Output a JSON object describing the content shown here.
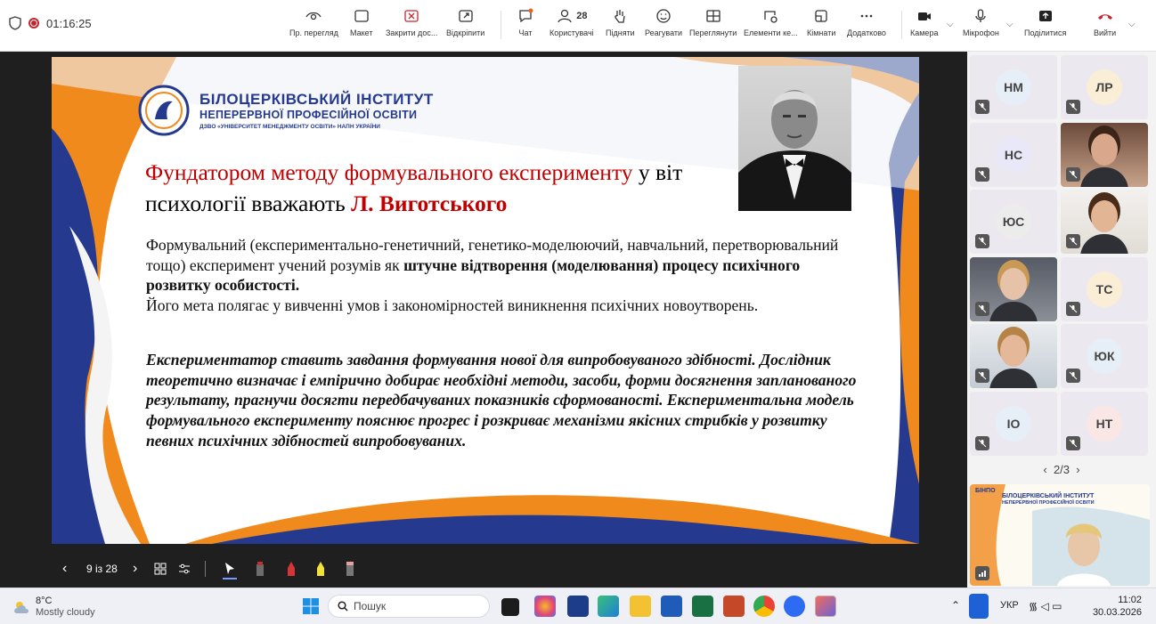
{
  "meeting": {
    "timer": "01:16:25"
  },
  "toolbar": {
    "view": "Пр. перегляд",
    "layout": "Макет",
    "close_content": "Закрити дос...",
    "undock": "Відкріпити",
    "chat": "Чат",
    "people": "Користувачі",
    "people_count": "28",
    "raise": "Підняти",
    "react": "Реагувати",
    "view_mode": "Переглянути",
    "apps": "Елементи ке...",
    "rooms": "Кімнати",
    "more": "Додатково",
    "camera": "Камера",
    "mic": "Мікрофон",
    "share": "Поділитися",
    "leave": "Вийти"
  },
  "slide": {
    "institute_line1": "БІЛОЦЕРКІВСЬКИЙ ІНСТИТУТ",
    "institute_line2": "НЕПЕРЕРВНОЇ ПРОФЕСІЙНОЇ ОСВІТИ",
    "institute_line3": "ДЗВО «УНІВЕРСИТЕТ МЕНЕДЖМЕНТУ ОСВІТИ» НАПН УКРАЇНИ",
    "title_red": "Фундатором методу формувального експерименту",
    "title_black": " у віт",
    "title_line2": "психології вважають ",
    "title_name": "Л. Виготського",
    "p1_a": "Формувальний (експериментально-генетичний, генетико-моделюючий, навчальний, перетворювальний тощо) експеримент учений розумів як ",
    "p1_bold": "штучне відтворення (моделювання) процесу психічного розвитку особистості.",
    "p1_b": "Його мета полягає у вивченні умов і закономірностей виникнення психічних новоутворень.",
    "p2": "Експериментатор ставить завдання формування нової для випробовуваного здібності. Дослідник теоретично визначає і емпірично добирає необхідні методи, засоби, форми досягнення запланованого результату, прагнучи досягти передбачуваних показників сформованості. Експериментальна модель формувального експерименту пояснює прогрес і розкриває механізми якісних стрибків у розвитку певних психічних здібностей випробовуваних."
  },
  "pager": {
    "label": "9 із 28"
  },
  "participants": [
    {
      "initials": "НМ",
      "color": "#e6eff8"
    },
    {
      "initials": "ЛР",
      "color": "#fbeed7"
    },
    {
      "initials": "НС",
      "color": "#e8e8f8"
    },
    {
      "initials": "",
      "color": ""
    },
    {
      "initials": "ЮС",
      "color": "#ececec"
    },
    {
      "initials": "",
      "color": ""
    },
    {
      "initials": "",
      "color": ""
    },
    {
      "initials": "ТС",
      "color": "#fbeed7"
    },
    {
      "initials": "",
      "color": ""
    },
    {
      "initials": "ЮК",
      "color": "#e6eff8"
    },
    {
      "initials": "ІО",
      "color": "#e6eff8"
    },
    {
      "initials": "НТ",
      "color": "#fbe6e6"
    }
  ],
  "gallery_page": "2/3",
  "thumb": {
    "brand": "БІНПО",
    "line1": "БІЛОЦЕРКІВСЬКИЙ ІНСТИТУТ",
    "line2": "НЕПЕРЕРВНОЇ ПРОФЕСІЙНОЇ ОСВІТИ"
  },
  "taskbar": {
    "temp": "8°C",
    "weather": "Mostly cloudy",
    "search": "Пошук",
    "lang": "УКР",
    "time": "11:02",
    "date": "30.03.2026"
  }
}
